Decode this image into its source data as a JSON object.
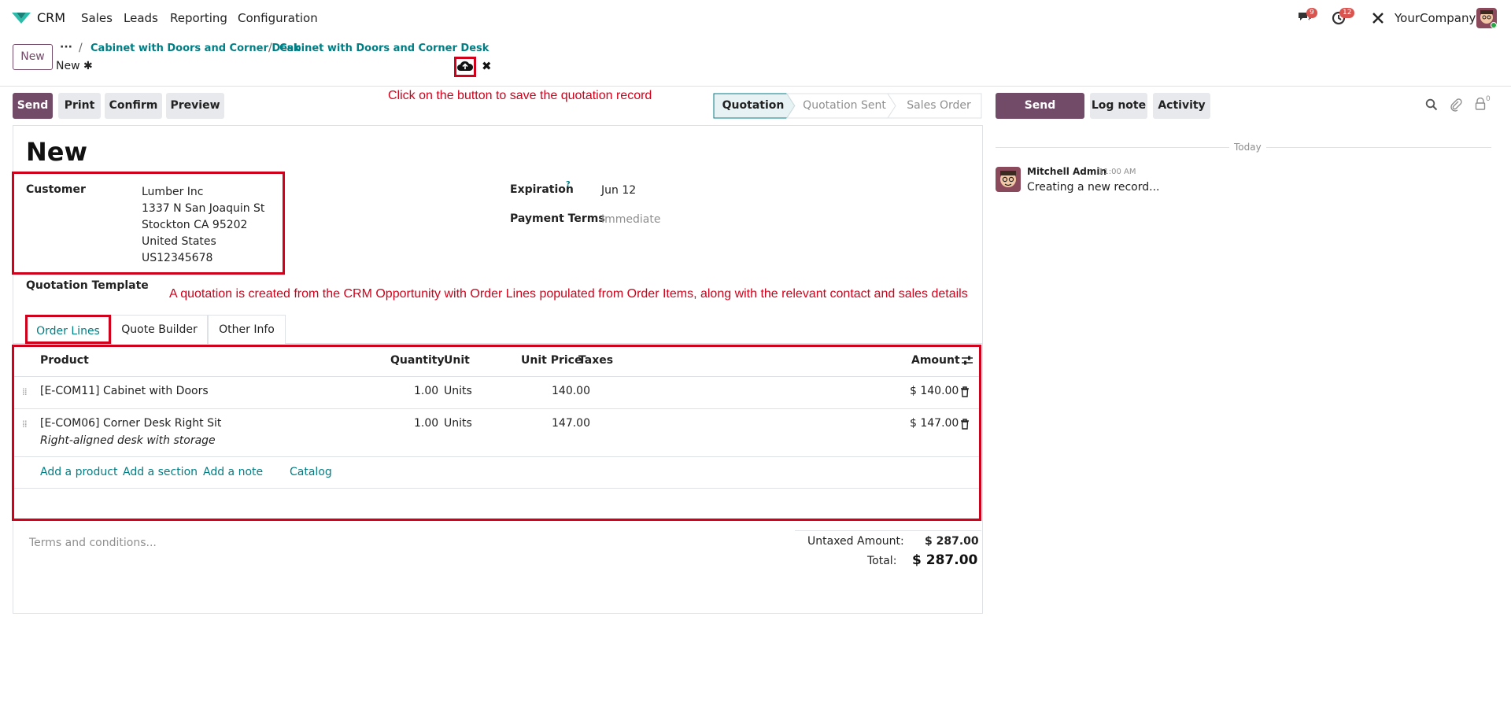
{
  "nav": {
    "app": "CRM",
    "menu": [
      "Sales",
      "Leads",
      "Reporting",
      "Configuration"
    ],
    "messages_badge": "9",
    "activities_badge": "12",
    "company": "YourCompany",
    "brand_color": "#714b67"
  },
  "breadcrumb": {
    "new_button": "New",
    "dots": "···",
    "items": [
      "Cabinet with Doors and Corner Desk",
      "Cabinet with Doors and Corner Desk"
    ],
    "record": "New"
  },
  "actions": {
    "send": "Send",
    "print": "Print",
    "confirm": "Confirm",
    "preview": "Preview"
  },
  "annotations": {
    "save_hint": "Click on the button to save the quotation record",
    "info": "A quotation is created from the CRM Opportunity with Order Lines populated from Order Items, along with the relevant contact and sales details",
    "annotation_color": "#d0021b"
  },
  "statusbar": [
    "Quotation",
    "Quotation Sent",
    "Sales Order"
  ],
  "form": {
    "title": "New",
    "customer_label": "Customer",
    "customer_lines": [
      "Lumber Inc",
      "1337 N San Joaquin St",
      "Stockton CA 95202",
      "United States",
      "US12345678"
    ],
    "expiration_label": "Expiration",
    "expiration_help": "?",
    "expiration_value": "Jun 12",
    "payment_terms_label": "Payment Terms",
    "payment_terms_placeholder": "Immediate",
    "template_label": "Quotation Template"
  },
  "tabs": [
    "Order Lines",
    "Quote Builder",
    "Other Info"
  ],
  "order_lines": {
    "headers": {
      "product": "Product",
      "quantity": "Quantity",
      "unit": "Unit",
      "unit_price": "Unit Price",
      "taxes": "Taxes",
      "amount": "Amount"
    },
    "rows": [
      {
        "product": "[E-COM11] Cabinet with Doors",
        "description": "",
        "quantity": "1.00",
        "unit": "Units",
        "unit_price": "140.00",
        "amount": "$ 140.00"
      },
      {
        "product": "[E-COM06] Corner Desk Right Sit",
        "description": "Right-aligned desk with storage",
        "quantity": "1.00",
        "unit": "Units",
        "unit_price": "147.00",
        "amount": "$ 147.00"
      }
    ],
    "add_product": "Add a product",
    "add_section": "Add a section",
    "add_note": "Add a note",
    "catalog": "Catalog"
  },
  "footer": {
    "terms_placeholder": "Terms and conditions...",
    "untaxed_label": "Untaxed Amount:",
    "untaxed_value": "$ 287.00",
    "total_label": "Total:",
    "total_value": "$ 287.00"
  },
  "chatter": {
    "send_message": "Send message",
    "log_note": "Log note",
    "activity": "Activity",
    "followers_count": "0",
    "today": "Today",
    "author": "Mitchell Admin",
    "time": "11:00 AM",
    "message": "Creating a new record..."
  }
}
